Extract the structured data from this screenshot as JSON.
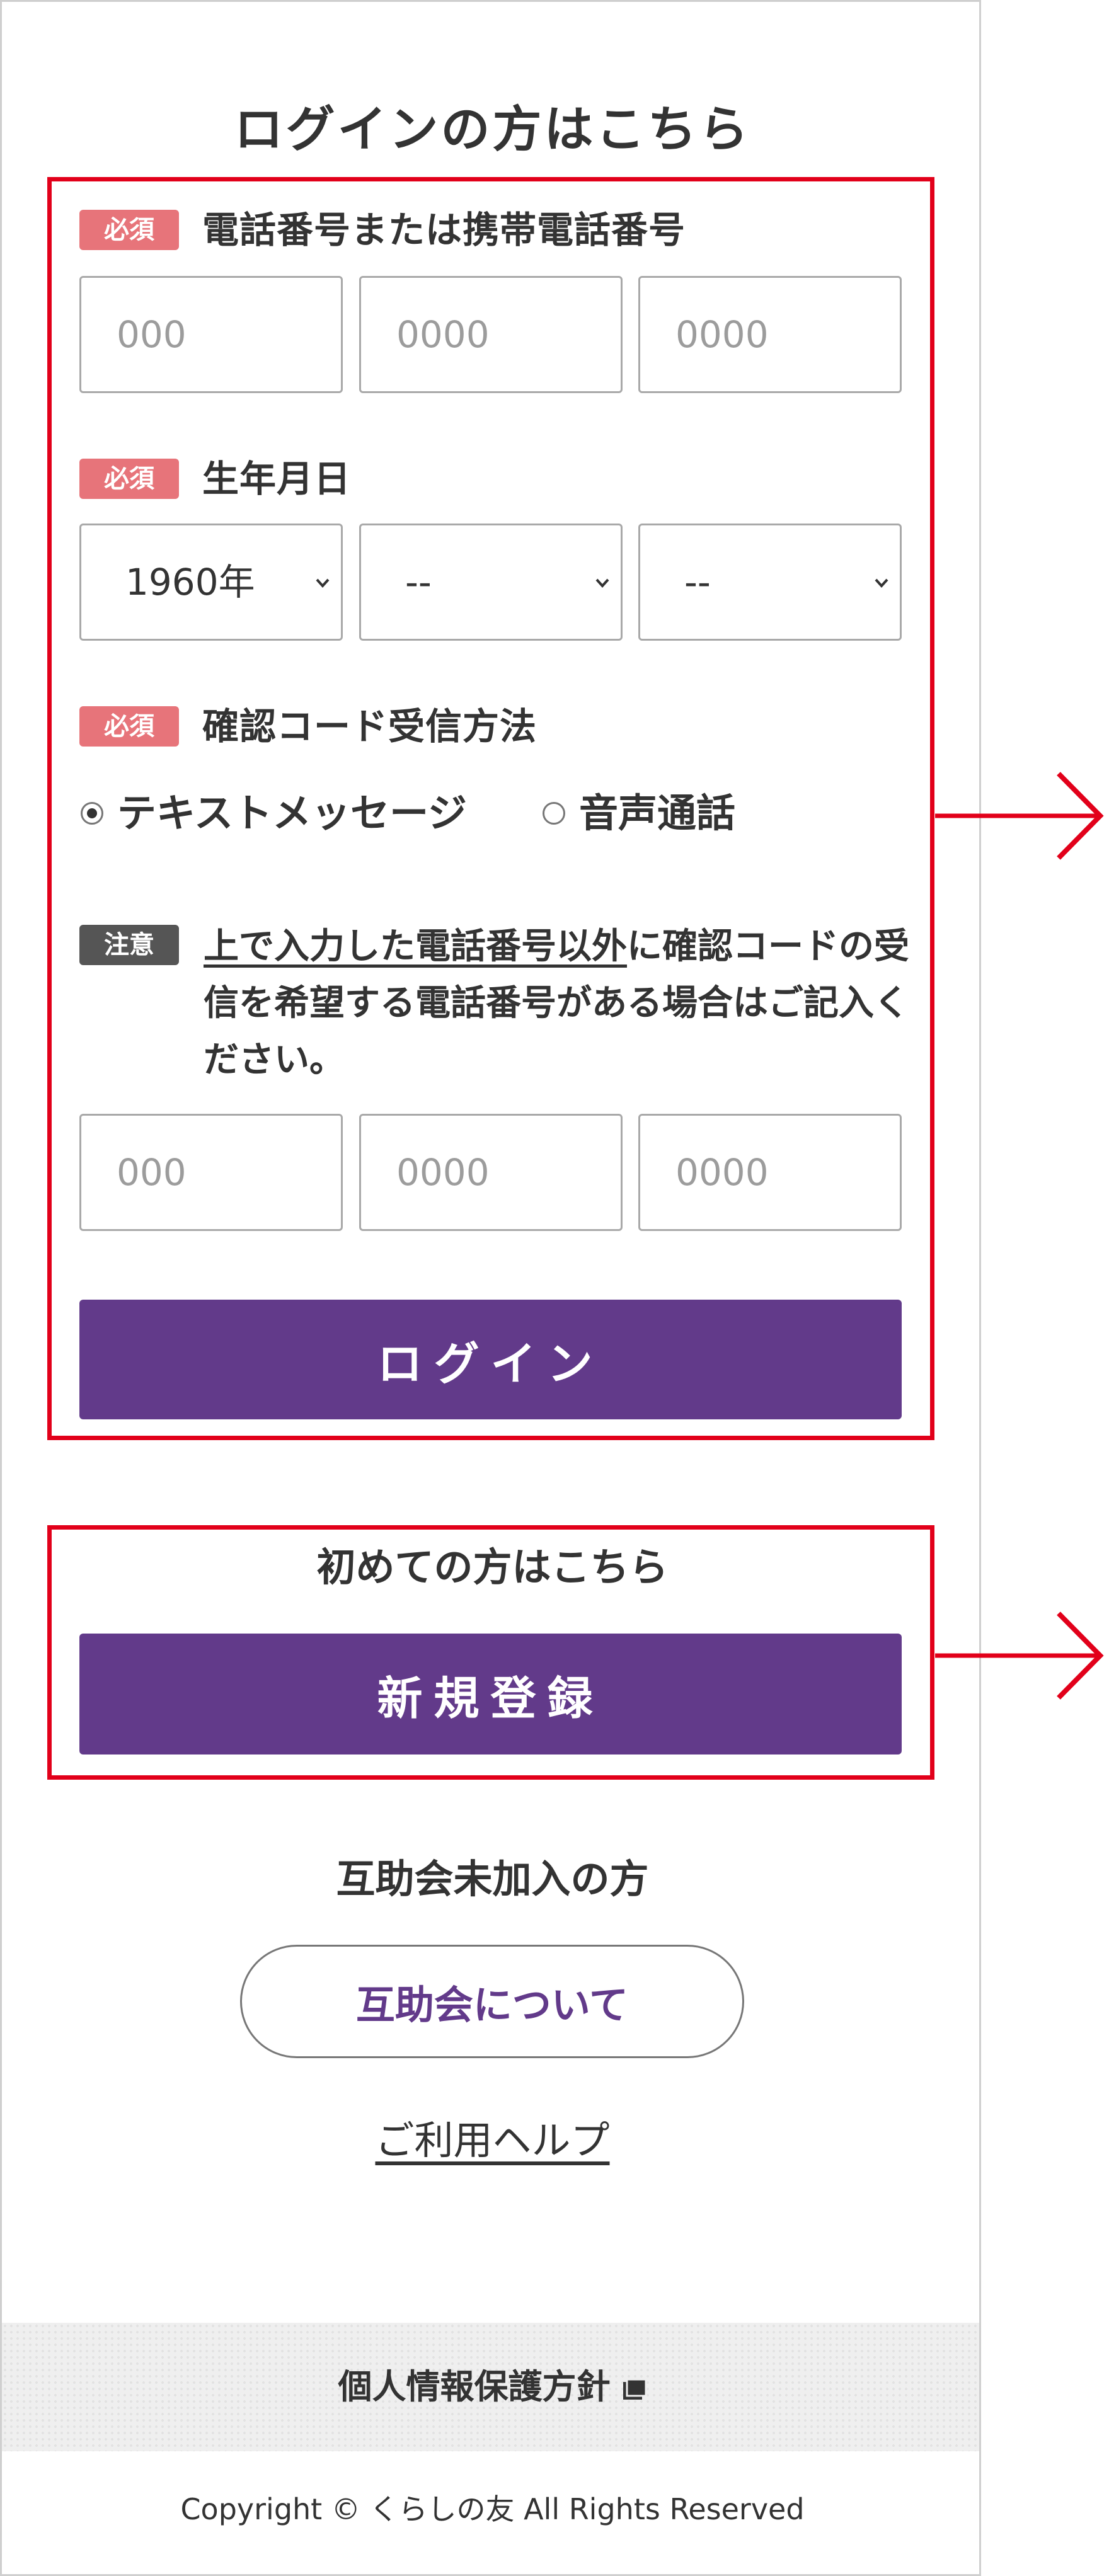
{
  "login_section": {
    "title": "ログインの方はこちら",
    "phone": {
      "badge": "必須",
      "label": "電話番号または携帯電話番号",
      "placeholders": [
        "000",
        "0000",
        "0000"
      ]
    },
    "birthdate": {
      "badge": "必須",
      "label": "生年月日",
      "year": "1960年",
      "month": "--",
      "day": "--"
    },
    "verification": {
      "badge": "必須",
      "label": "確認コード受信方法",
      "options": [
        "テキストメッセージ",
        "音声通話"
      ],
      "selected": "テキストメッセージ"
    },
    "alt_phone": {
      "badge": "注意",
      "note_underlined": "上で入力した電話番号以外",
      "note_rest": "に確認コードの受信を希望する電話番号がある場合はご記入ください。",
      "placeholders": [
        "000",
        "0000",
        "0000"
      ]
    },
    "login_button": "ログイン"
  },
  "new_user_section": {
    "title": "初めての方はこちら",
    "button": "新規登録"
  },
  "non_member_section": {
    "title": "互助会未加入の方",
    "button": "互助会について"
  },
  "help_link": "ご利用ヘルプ",
  "footer": {
    "privacy_link": "個人情報保護方針",
    "copyright": "Copyright © くらしの友 All Rights Reserved"
  },
  "colors": {
    "brand_purple": "#623a8a",
    "required_badge": "#e7747a",
    "notice_badge": "#555555",
    "callout_red": "#e2001a"
  },
  "icons": {
    "select_chevron": "chevron-down-icon",
    "callout_arrow": "arrow-right-icon",
    "external_window": "new-window-icon"
  }
}
